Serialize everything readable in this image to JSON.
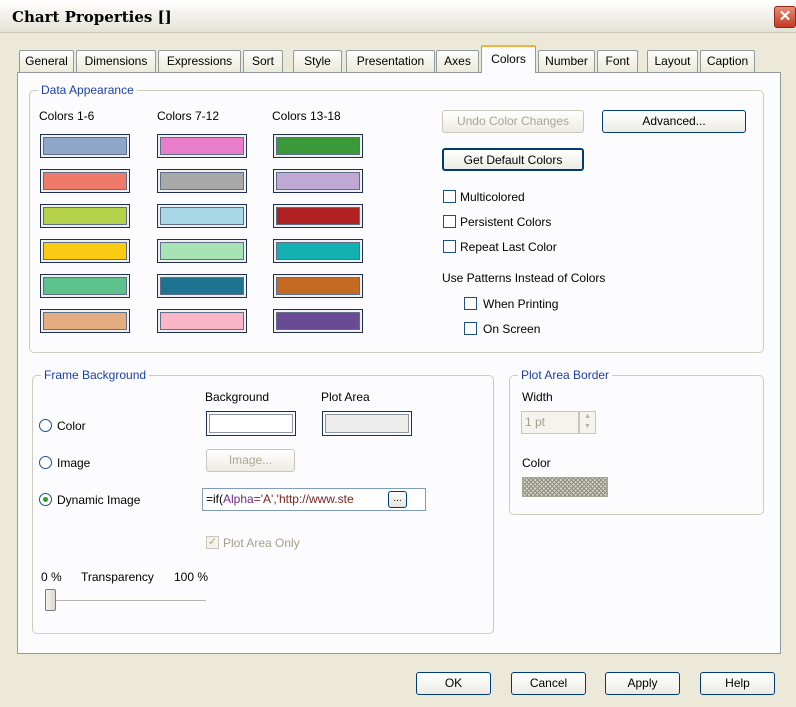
{
  "window": {
    "title": "Chart Properties []",
    "close_glyph": "✕"
  },
  "tabs": [
    {
      "label": "General",
      "active": false
    },
    {
      "label": "Dimensions",
      "active": false
    },
    {
      "label": "Expressions",
      "active": false
    },
    {
      "label": "Sort",
      "active": false
    },
    {
      "label": "Style",
      "active": false
    },
    {
      "label": "Presentation",
      "active": false
    },
    {
      "label": "Axes",
      "active": false
    },
    {
      "label": "Colors",
      "active": true
    },
    {
      "label": "Number",
      "active": false
    },
    {
      "label": "Font",
      "active": false
    },
    {
      "label": "Layout",
      "active": false
    },
    {
      "label": "Caption",
      "active": false
    }
  ],
  "data_appearance": {
    "title": "Data Appearance",
    "column_labels": [
      "Colors 1-6",
      "Colors 7-12",
      "Colors 13-18"
    ],
    "colors": [
      [
        "#8ea7c8",
        "#f07a6a",
        "#b5d14a",
        "#fccc12",
        "#5cc18a",
        "#e4ad80"
      ],
      [
        "#e87dca",
        "#a9a9a9",
        "#a8d8e6",
        "#a6e4b6",
        "#1e7390",
        "#f8b6c6"
      ],
      [
        "#3a9a3a",
        "#c0a8d4",
        "#b02222",
        "#12b0b0",
        "#c56a22",
        "#6a4a94"
      ]
    ],
    "undo_button": "Undo Color Changes",
    "advanced_button": "Advanced...",
    "default_colors_button": "Get Default Colors",
    "checkboxes": [
      {
        "label": "Multicolored",
        "checked": false
      },
      {
        "label": "Persistent Colors",
        "checked": false
      },
      {
        "label": "Repeat Last Color",
        "checked": false
      }
    ],
    "patterns_label": "Use Patterns Instead of Colors",
    "pattern_options": [
      {
        "label": "When Printing",
        "checked": false
      },
      {
        "label": "On Screen",
        "checked": false
      }
    ]
  },
  "frame_background": {
    "title": "Frame Background",
    "background_header": "Background",
    "plot_area_header": "Plot Area",
    "background_color": "#ffffff",
    "plot_area_color": "#ececea",
    "radio_options": [
      {
        "label": "Color",
        "selected": false
      },
      {
        "label": "Image",
        "selected": false
      },
      {
        "label": "Dynamic Image",
        "selected": true
      }
    ],
    "image_button": "Image...",
    "dynamic_image_parts": [
      "=if(",
      "Alpha",
      "='A','http://www.ste"
    ],
    "ellipsis_button": "...",
    "plot_area_only_label": "Plot Area Only",
    "plot_area_only_checked": true,
    "transparency_min": "0 %",
    "transparency_label": "Transparency",
    "transparency_max": "100 %",
    "transparency_value": 0
  },
  "plot_area_border": {
    "title": "Plot Area Border",
    "width_label": "Width",
    "width_value": "1 pt",
    "color_label": "Color"
  },
  "footer": {
    "ok": "OK",
    "cancel": "Cancel",
    "apply": "Apply",
    "help": "Help"
  }
}
